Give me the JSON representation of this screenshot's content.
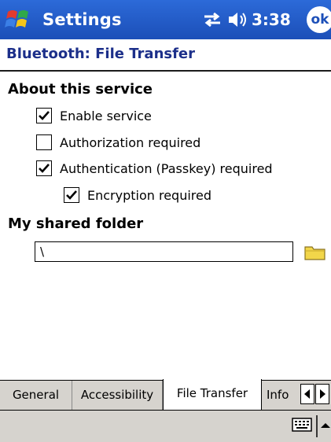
{
  "titlebar": {
    "app_title": "Settings",
    "time": "3:38",
    "ok_label": "ok",
    "start_icon": "windows-flag-icon",
    "connectivity_icon": "connectivity-icon",
    "volume_icon": "speaker-icon",
    "color": "#1f5ac8"
  },
  "page": {
    "heading": "Bluetooth: File Transfer",
    "heading_color": "#1c2f8a"
  },
  "about": {
    "title": "About this service",
    "options": [
      {
        "label": "Enable service",
        "checked": true
      },
      {
        "label": "Authorization required",
        "checked": false
      },
      {
        "label": "Authentication (Passkey) required",
        "checked": true
      },
      {
        "label": "Encryption required",
        "checked": true
      }
    ]
  },
  "folder": {
    "title": "My shared folder",
    "value": "\\",
    "browse_icon": "folder-icon"
  },
  "tabs": [
    {
      "label": "General",
      "active": false
    },
    {
      "label": "Accessibility",
      "active": false
    },
    {
      "label": "File Transfer",
      "active": true
    },
    {
      "label": "Info",
      "active": false
    }
  ],
  "menubar": {
    "keyboard_icon": "keyboard-icon",
    "sip_arrow_icon": "arrow-up-icon"
  }
}
